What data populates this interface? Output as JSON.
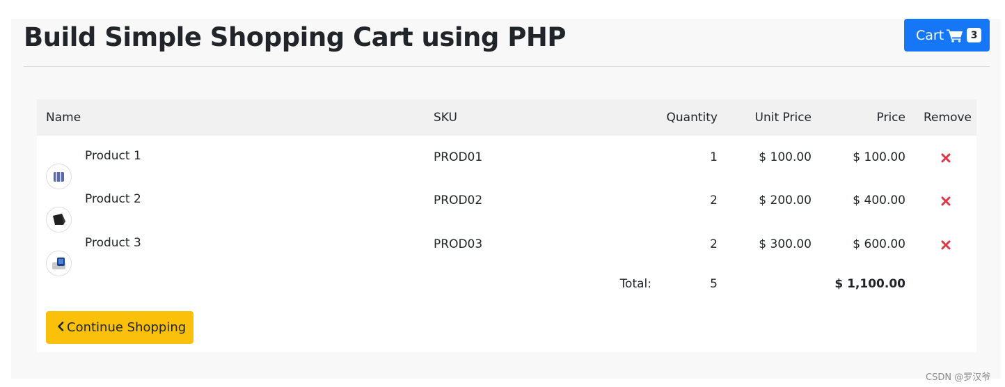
{
  "header": {
    "title": "Build Simple Shopping Cart using PHP",
    "cart_label": "Cart",
    "cart_count": "3"
  },
  "table": {
    "columns": {
      "name": "Name",
      "sku": "SKU",
      "quantity": "Quantity",
      "unit_price": "Unit Price",
      "price": "Price",
      "remove": "Remove"
    },
    "rows": [
      {
        "name": "Product 1",
        "sku": "PROD01",
        "quantity": "1",
        "unit_price": "$ 100.00",
        "price": "$ 100.00",
        "thumb_icon": "product-1-thumbnail"
      },
      {
        "name": "Product 2",
        "sku": "PROD02",
        "quantity": "2",
        "unit_price": "$ 200.00",
        "price": "$ 400.00",
        "thumb_icon": "product-2-thumbnail"
      },
      {
        "name": "Product 3",
        "sku": "PROD03",
        "quantity": "2",
        "unit_price": "$ 300.00",
        "price": "$ 600.00",
        "thumb_icon": "product-3-thumbnail"
      }
    ],
    "total": {
      "label": "Total:",
      "quantity": "5",
      "price": "$ 1,100.00"
    }
  },
  "actions": {
    "continue_label": "Continue Shopping"
  },
  "watermark": "CSDN @罗汉爷",
  "colors": {
    "primary": "#1577f6",
    "warning": "#fbc10a",
    "danger": "#dc3545"
  }
}
